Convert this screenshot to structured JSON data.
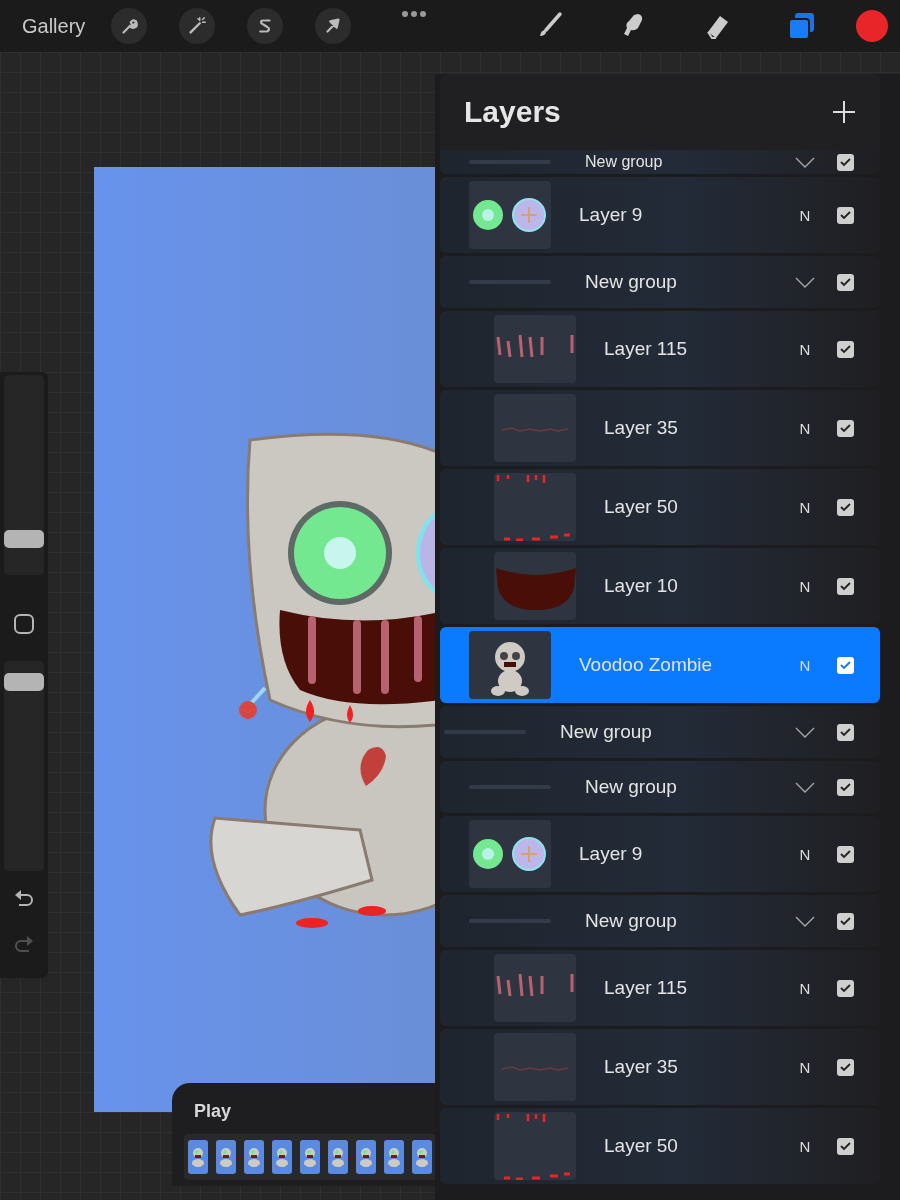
{
  "toolbar": {
    "gallery": "Gallery"
  },
  "sidebar": {
    "brush_size": {
      "level": 0.15
    },
    "opacity": {
      "level": 0.94
    },
    "redo": {
      "disabled": true
    }
  },
  "layers_panel": {
    "title": "Layers"
  },
  "layers": [
    {
      "kind": "continued",
      "children": [
        {
          "kind": "group",
          "name": "New group",
          "expanded": true,
          "visible": true,
          "selected": false
        },
        {
          "kind": "layer",
          "name": "Layer 9",
          "thumbnail": {
            "kind": "eyes"
          },
          "blend": "N",
          "visible": true,
          "selected": false
        },
        {
          "kind": "group",
          "name": "New group",
          "expanded": true,
          "visible": true,
          "selected": false,
          "children": [
            {
              "kind": "layer",
              "name": "Layer 115",
              "thumbnail": {
                "kind": "stripes"
              },
              "blend": "N",
              "visible": true,
              "selected": false
            },
            {
              "kind": "layer",
              "name": "Layer 35",
              "thumbnail": {
                "kind": "dashes"
              },
              "blend": "N",
              "visible": true,
              "selected": false
            },
            {
              "kind": "layer",
              "name": "Layer 50",
              "thumbnail": {
                "kind": "drips"
              },
              "blend": "N",
              "visible": true,
              "selected": false
            },
            {
              "kind": "layer",
              "name": "Layer 10",
              "thumbnail": {
                "kind": "mouth"
              },
              "blend": "N",
              "visible": true,
              "selected": false
            }
          ]
        },
        {
          "kind": "layer",
          "name": "Voodoo Zombie",
          "thumbnail": {
            "kind": "doll"
          },
          "blend": "N",
          "visible": true,
          "selected": true
        }
      ]
    },
    {
      "kind": "group",
      "name": "New group",
      "expanded": true,
      "visible": true,
      "selected": false,
      "children": [
        {
          "kind": "group",
          "name": "New group",
          "expanded": true,
          "visible": true,
          "selected": false
        },
        {
          "kind": "layer",
          "name": "Layer 9",
          "thumbnail": {
            "kind": "eyes"
          },
          "blend": "N",
          "visible": true,
          "selected": false
        },
        {
          "kind": "group",
          "name": "New group",
          "expanded": true,
          "visible": true,
          "selected": false,
          "children": [
            {
              "kind": "layer",
              "name": "Layer 115",
              "thumbnail": {
                "kind": "stripes"
              },
              "blend": "N",
              "visible": true,
              "selected": false
            },
            {
              "kind": "layer",
              "name": "Layer 35",
              "thumbnail": {
                "kind": "dashes"
              },
              "blend": "N",
              "visible": true,
              "selected": false
            },
            {
              "kind": "layer",
              "name": "Layer 50",
              "thumbnail": {
                "kind": "drips"
              },
              "blend": "N",
              "visible": true,
              "selected": false
            }
          ]
        }
      ]
    }
  ],
  "timeline": {
    "title": "Play"
  }
}
